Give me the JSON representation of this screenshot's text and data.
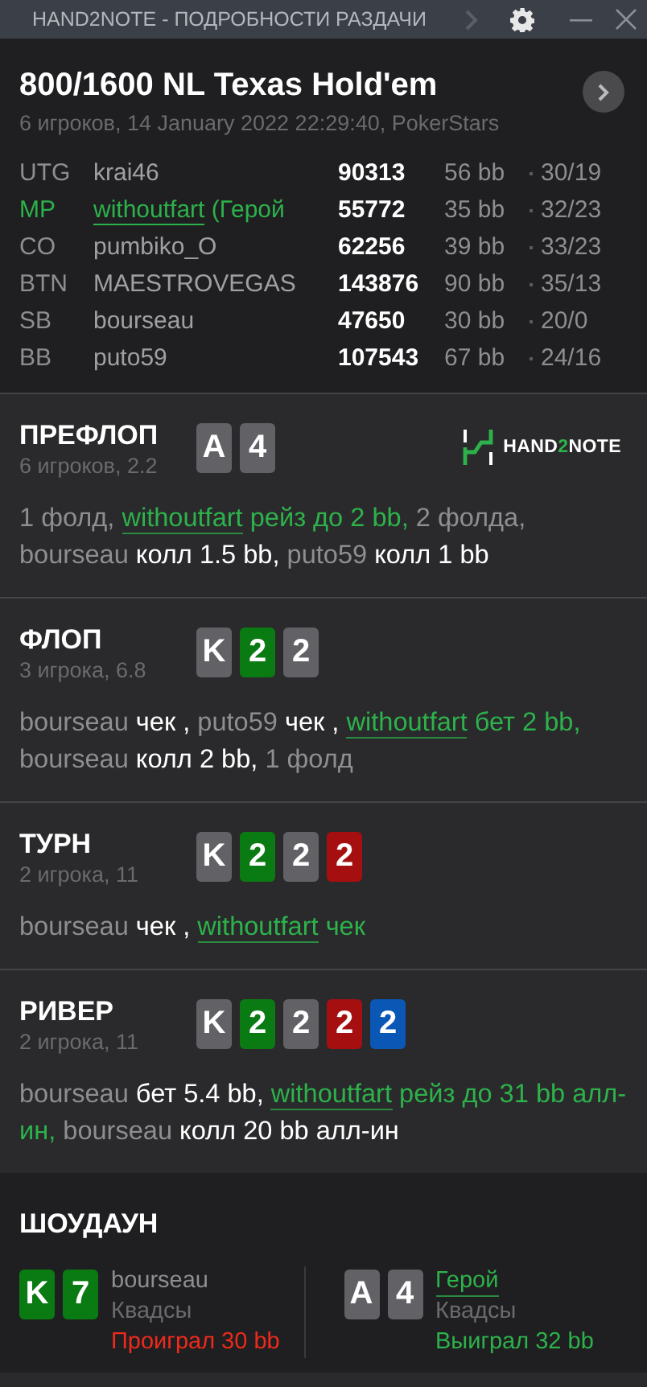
{
  "window": {
    "title": "HAND2NOTE - ПОДРОБНОСТИ РАЗДАЧИ"
  },
  "hand": {
    "title": "800/1600 NL Texas Hold'em",
    "subtitle": "6 игроков, 14 January 2022 22:29:40, PokerStars"
  },
  "players": [
    {
      "position": "UTG",
      "name": "krai46",
      "hero": false,
      "stack": "90313",
      "bb": "56 bb",
      "stats": "30/19"
    },
    {
      "position": "MP",
      "name": "withoutfart",
      "hero": true,
      "hero_tag": "(Герой",
      "stack": "55772",
      "bb": "35 bb",
      "stats": "32/23"
    },
    {
      "position": "CO",
      "name": "pumbiko_O",
      "hero": false,
      "stack": "62256",
      "bb": "39 bb",
      "stats": "33/23"
    },
    {
      "position": "BTN",
      "name": "MAESTROVEGAS",
      "hero": false,
      "stack": "143876",
      "bb": "90 bb",
      "stats": "35/13"
    },
    {
      "position": "SB",
      "name": "bourseau",
      "hero": false,
      "stack": "47650",
      "bb": "30 bb",
      "stats": "20/0"
    },
    {
      "position": "BB",
      "name": "puto59",
      "hero": false,
      "stack": "107543",
      "bb": "67 bb",
      "stats": "24/16"
    }
  ],
  "streets": [
    {
      "name": "ПРЕФЛОП",
      "info": "6 игроков, 2.2",
      "cards": [
        {
          "rank": "A",
          "color": "#626266"
        },
        {
          "rank": "4",
          "color": "#626266"
        }
      ],
      "logo": {
        "parts": [
          {
            "text": "HAND",
            "accent": false
          },
          {
            "text": "2",
            "accent": true
          },
          {
            "text": "NOTE",
            "accent": false
          }
        ]
      },
      "actions": [
        {
          "kind": "plain",
          "text": "1 фолд, "
        },
        {
          "kind": "hero",
          "text": "withoutfart"
        },
        {
          "kind": "hero_action",
          "text": " рейз до 2 bb,"
        },
        {
          "kind": "plain",
          "text": " 2 фолда, "
        },
        {
          "kind": "player",
          "text": "bourseau"
        },
        {
          "kind": "action",
          "text": " колл 1.5 bb,"
        },
        {
          "kind": "player",
          "text": " puto59"
        },
        {
          "kind": "action",
          "text": " колл 1 bb"
        }
      ]
    },
    {
      "name": "ФЛОП",
      "info": "3 игрока, 6.8",
      "cards": [
        {
          "rank": "K",
          "color": "#626266"
        },
        {
          "rank": "2",
          "color": "#0a7a12"
        },
        {
          "rank": "2",
          "color": "#626266"
        }
      ],
      "actions": [
        {
          "kind": "player",
          "text": "bourseau"
        },
        {
          "kind": "action",
          "text": " чек ,"
        },
        {
          "kind": "player",
          "text": " puto59"
        },
        {
          "kind": "action",
          "text": " чек , "
        },
        {
          "kind": "hero",
          "text": "withoutfart"
        },
        {
          "kind": "hero_action",
          "text": " бет 2 bb,"
        },
        {
          "kind": "player",
          "text": " bourseau"
        },
        {
          "kind": "action",
          "text": " колл 2 bb,"
        },
        {
          "kind": "plain",
          "text": " 1 фолд"
        }
      ]
    },
    {
      "name": "ТУРН",
      "info": "2 игрока, 11",
      "cards": [
        {
          "rank": "K",
          "color": "#626266"
        },
        {
          "rank": "2",
          "color": "#0a7a12"
        },
        {
          "rank": "2",
          "color": "#626266"
        },
        {
          "rank": "2",
          "color": "#a50f0f"
        }
      ],
      "actions": [
        {
          "kind": "player",
          "text": "bourseau"
        },
        {
          "kind": "action",
          "text": " чек , "
        },
        {
          "kind": "hero",
          "text": "withoutfart"
        },
        {
          "kind": "hero_action",
          "text": " чек"
        }
      ]
    },
    {
      "name": "РИВЕР",
      "info": "2 игрока, 11",
      "cards": [
        {
          "rank": "K",
          "color": "#626266"
        },
        {
          "rank": "2",
          "color": "#0a7a12"
        },
        {
          "rank": "2",
          "color": "#626266"
        },
        {
          "rank": "2",
          "color": "#a50f0f"
        },
        {
          "rank": "2",
          "color": "#0a57b5"
        }
      ],
      "actions": [
        {
          "kind": "player",
          "text": "bourseau"
        },
        {
          "kind": "action",
          "text": " бет 5.4 bb, "
        },
        {
          "kind": "hero",
          "text": "withoutfart"
        },
        {
          "kind": "hero_action",
          "text": " рейз до 31 bb алл-ин,"
        },
        {
          "kind": "player",
          "text": " bourseau"
        },
        {
          "kind": "action",
          "text": " колл 20 bb алл-ин"
        }
      ]
    }
  ],
  "showdown": {
    "title": "ШОУДАУН",
    "hands": [
      {
        "cards": [
          {
            "rank": "K",
            "color": "#0a7a12"
          },
          {
            "rank": "7",
            "color": "#0a7a12"
          }
        ],
        "name": "bourseau",
        "hero": false,
        "combo": "Квадсы",
        "result": "Проиграл 30 bb",
        "won": false
      },
      {
        "cards": [
          {
            "rank": "A",
            "color": "#626266"
          },
          {
            "rank": "4",
            "color": "#626266"
          }
        ],
        "name": "Герой",
        "hero": true,
        "combo": "Квадсы",
        "result": "Выиграл 32 bb",
        "won": true
      }
    ]
  }
}
